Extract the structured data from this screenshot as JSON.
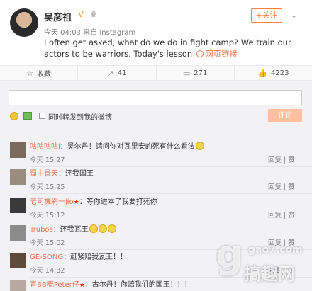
{
  "post": {
    "author": "吴彦祖",
    "follow_label": "+关注",
    "meta": "今天 04:03 来自 Instagram",
    "content": "I often get asked, what do we do in fight camp? We train our actors to be warriors. Today's lesson",
    "link_label": "网页链接"
  },
  "actions": {
    "favorite": "收藏",
    "repost": "41",
    "comments": "271",
    "likes": "4223"
  },
  "comment_box": {
    "repost_label": "同时转发到我的微博",
    "submit_label": "评论"
  },
  "comments": [
    {
      "name": "咕咕咕咕l",
      "text": "：吴尔丹！请问你对瓦里安的死有什么看法",
      "time": "今天 15:27",
      "badge": "",
      "smileys": 1
    },
    {
      "name": "蜀中景天",
      "text": "：还我国王",
      "time": "今天 15:25",
      "badge": "",
      "smileys": 0
    },
    {
      "name": "老司機剁一jio",
      "text": "：等你进本了我要打死你",
      "time": "今天 15:12",
      "badge": "★",
      "smileys": 0
    },
    {
      "name": "Trubos",
      "text": "：还我瓦王",
      "time": "今天 15:02",
      "badge": "",
      "smileys": 3
    },
    {
      "name": "GE-SONG",
      "text": "：赶紧赔我瓦王！！",
      "time": "今天 14:32",
      "badge": "",
      "smileys": 0
    },
    {
      "name": "青BB嘅Peter仔",
      "text": "：古尔丹！你赔我们的国王！！！",
      "time": "",
      "badge": "★",
      "smileys": 0
    }
  ],
  "comment_actions": {
    "reply": "回复",
    "like": "赞"
  },
  "watermark": {
    "glyph": "g",
    "site": "gao7.com",
    "brand": "搞趣网"
  },
  "colors": {
    "accent": "#eb7350",
    "follow": "#ff8140",
    "button": "#ffc09f"
  }
}
